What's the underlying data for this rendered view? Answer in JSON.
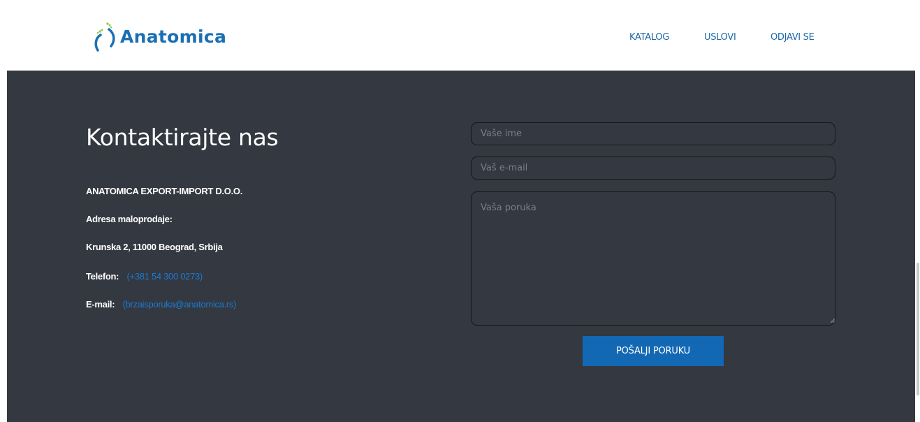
{
  "header": {
    "logo_text": "Anatomica",
    "nav": [
      "KATALOG",
      "USLOVI",
      "ODJAVI SE"
    ]
  },
  "contact": {
    "heading": "Kontaktirajte nas",
    "company": "ANATOMICA EXPORT-IMPORT D.O.O.",
    "address_label": "Adresa maloprodaje:",
    "address": "Krunska 2, 11000 Beograd, Srbija",
    "phone_label": "Telefon:",
    "phone": "(+381 54 300 0273)",
    "email_label": "E-mail:",
    "email": "(brzaisporuka@anatomica.rs)"
  },
  "form": {
    "name_placeholder": "Vaše ime",
    "email_placeholder": "Vaš e-mail",
    "message_placeholder": "Vaša poruka",
    "submit_label": "POŠALJI PORUKU"
  },
  "colors": {
    "brand_blue": "#1a6fb4",
    "button_blue": "#1368b4",
    "link_blue": "#1c79d4",
    "dark_bg": "#343840"
  }
}
